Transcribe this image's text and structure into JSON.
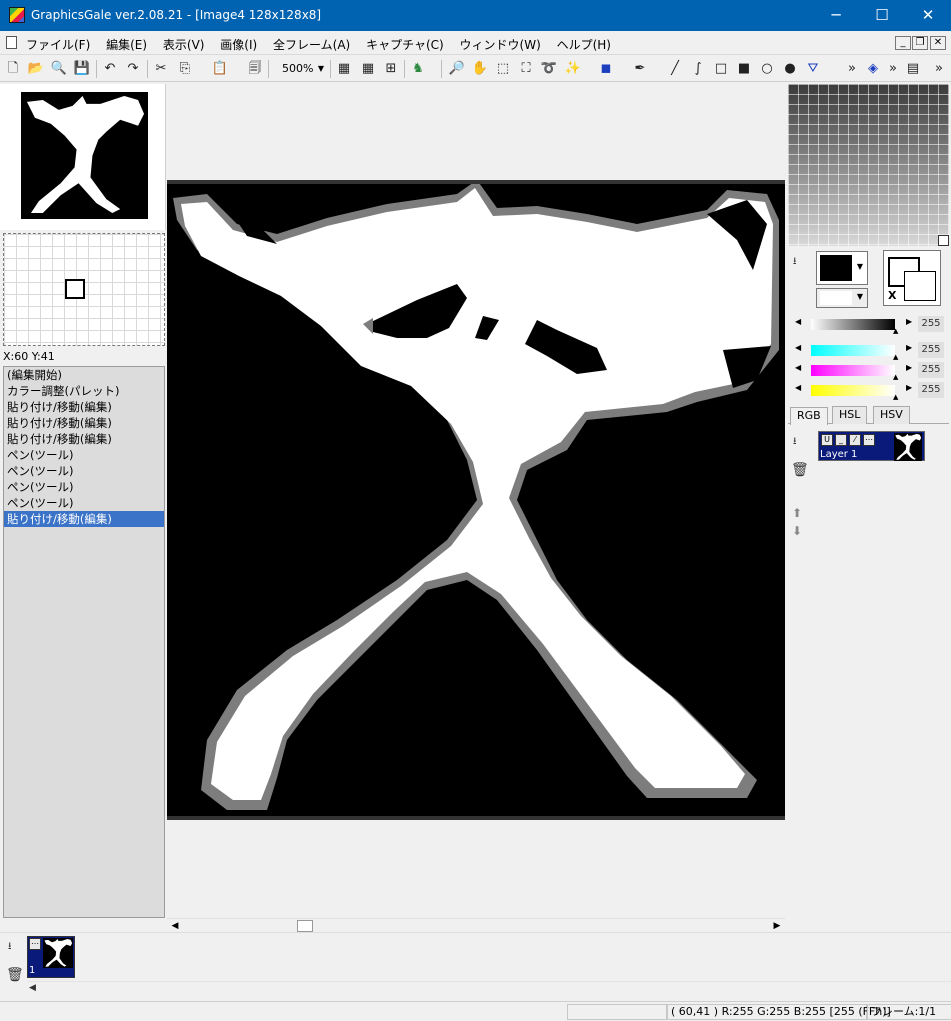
{
  "window": {
    "title": "GraphicsGale ver.2.08.21 - [Image4 128x128x8]",
    "minimize": "─",
    "maximize": "☐",
    "close": "✕"
  },
  "menu": {
    "items": [
      "ファイル(F)",
      "編集(E)",
      "表示(V)",
      "画像(I)",
      "全フレーム(A)",
      "キャプチャ(C)",
      "ウィンドウ(W)",
      "ヘルプ(H)"
    ],
    "mdi": [
      "_",
      "❐",
      "✕"
    ]
  },
  "toolbar": {
    "zoom": "500%",
    "icons": [
      "new-icon",
      "open-icon",
      "preview-icon",
      "save-icon",
      "undo-icon",
      "redo-icon",
      "cut-icon",
      "copy-icon",
      "paste-icon",
      "paste-special-icon",
      "grid-icon",
      "pixel-grid-icon",
      "tile-icon",
      "animal-icon",
      "zoom-icon",
      "hand-icon",
      "rect-select-icon",
      "free-select-icon",
      "lasso-icon",
      "magic-wand-icon",
      "fill-select-icon",
      "dropper-icon",
      "line-icon",
      "curve-icon",
      "rect-icon",
      "filled-rect-icon",
      "ellipse-icon",
      "filled-ellipse-icon",
      "fill-icon",
      "more-icon",
      "stamp-icon",
      "more-icon",
      "frame-icon"
    ]
  },
  "navigator": {
    "coords": "X:60 Y:41"
  },
  "history": {
    "items": [
      "(編集開始)",
      "カラー調整(パレット)",
      "貼り付け/移動(編集)",
      "貼り付け/移動(編集)",
      "貼り付け/移動(編集)",
      "ペン(ツール)",
      "ペン(ツール)",
      "ペン(ツール)",
      "ペン(ツール)",
      "貼り付け/移動(編集)"
    ],
    "selected_index": 9
  },
  "color": {
    "swap_label": "X",
    "gray_value": "255",
    "r_value": "255",
    "g_value": "255",
    "b_value": "255",
    "tabs": [
      "RGB",
      "HSL",
      "HSV"
    ],
    "active_tab": "RGB",
    "fg": "#000000",
    "bg": "#ffffff"
  },
  "layers": {
    "name": "Layer 1"
  },
  "frames": {
    "number": "1"
  },
  "status": {
    "pixel": "( 60,41 ) R:255 G:255 B:255  [255 (FFh)]",
    "frame": "フレーム:1/1"
  }
}
